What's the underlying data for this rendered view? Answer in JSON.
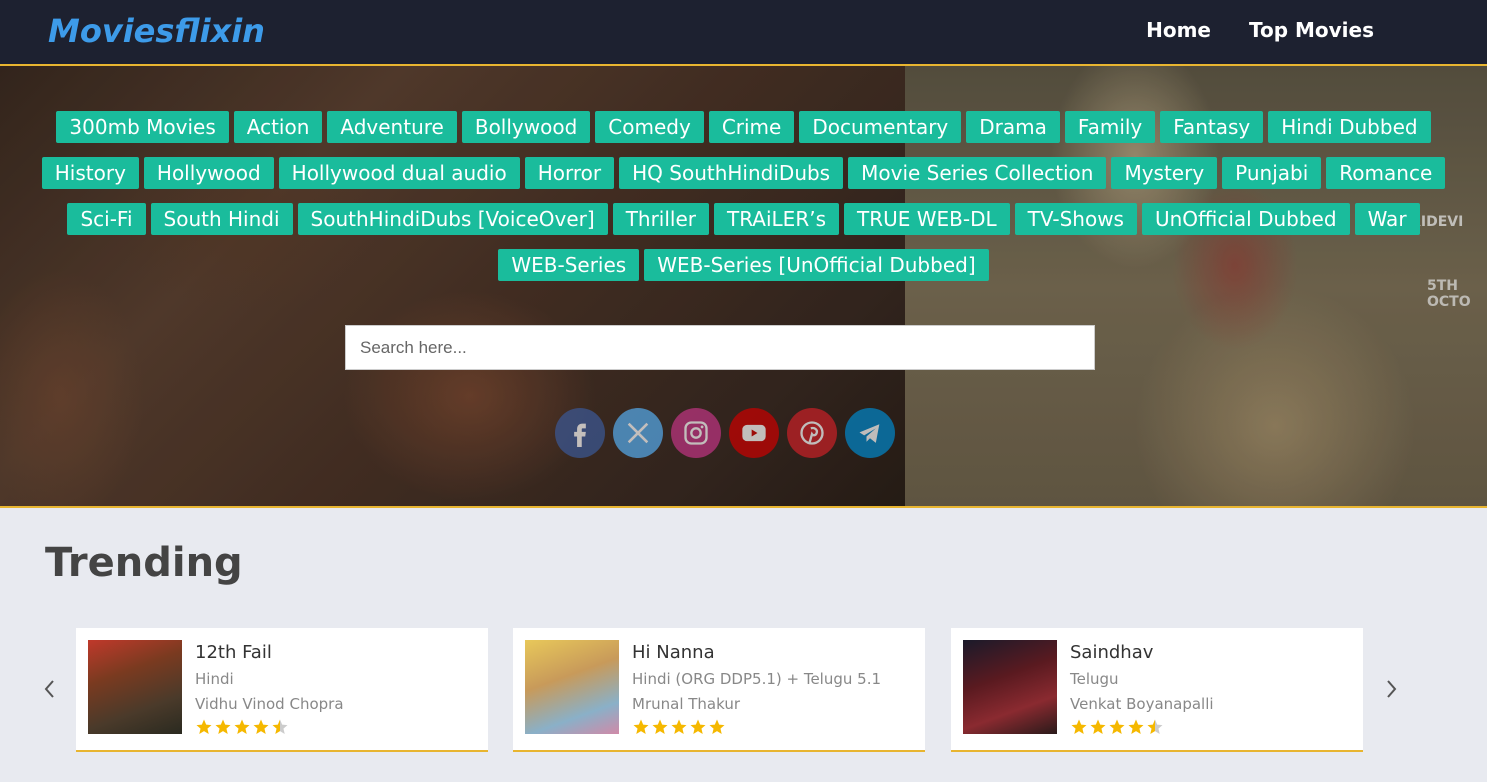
{
  "header": {
    "logo_text": "Moviesflixin",
    "nav": [
      "Home",
      "Top Movies"
    ]
  },
  "hero": {
    "bg_text_1": "SRIDEVI",
    "bg_text_2": "5TH OCTO",
    "categories": [
      "300mb Movies",
      "Action",
      "Adventure",
      "Bollywood",
      "Comedy",
      "Crime",
      "Documentary",
      "Drama",
      "Family",
      "Fantasy",
      "Hindi Dubbed",
      "History",
      "Hollywood",
      "Hollywood dual audio",
      "Horror",
      "HQ SouthHindiDubs",
      "Movie Series Collection",
      "Mystery",
      "Punjabi",
      "Romance",
      "Sci-Fi",
      "South Hindi",
      "SouthHindiDubs [VoiceOver]",
      "Thriller",
      "TRAiLER’s",
      "TRUE WEB-DL",
      "TV-Shows",
      "UnOfficial Dubbed",
      "War",
      "WEB-Series",
      "WEB-Series [UnOfficial Dubbed]"
    ],
    "search_placeholder": "Search here...",
    "social": [
      {
        "name": "facebook-icon",
        "color": "#3b5998"
      },
      {
        "name": "x-twitter-icon",
        "color": "#55acee"
      },
      {
        "name": "instagram-icon",
        "color": "#c13584"
      },
      {
        "name": "youtube-icon",
        "color": "#cc0000"
      },
      {
        "name": "pinterest-icon",
        "color": "#cb2027"
      },
      {
        "name": "telegram-icon",
        "color": "#0088cc"
      }
    ]
  },
  "trending": {
    "title": "Trending",
    "movies": [
      {
        "title": "12th Fail",
        "language": "Hindi",
        "director": "Vidhu Vinod Chopra",
        "rating": 4.5
      },
      {
        "title": "Hi Nanna",
        "language": "Hindi (ORG DDP5.1) + Telugu 5.1",
        "director": "Mrunal Thakur",
        "rating": 5
      },
      {
        "title": "Saindhav",
        "language": "Telugu",
        "director": "Venkat Boyanapalli",
        "rating": 4.5
      }
    ]
  },
  "colors": {
    "header_bg": "#1d2130",
    "accent": "#e8b530",
    "tag_bg": "#1abc9c",
    "logo": "#3d9be9",
    "star": "#f5b800"
  }
}
